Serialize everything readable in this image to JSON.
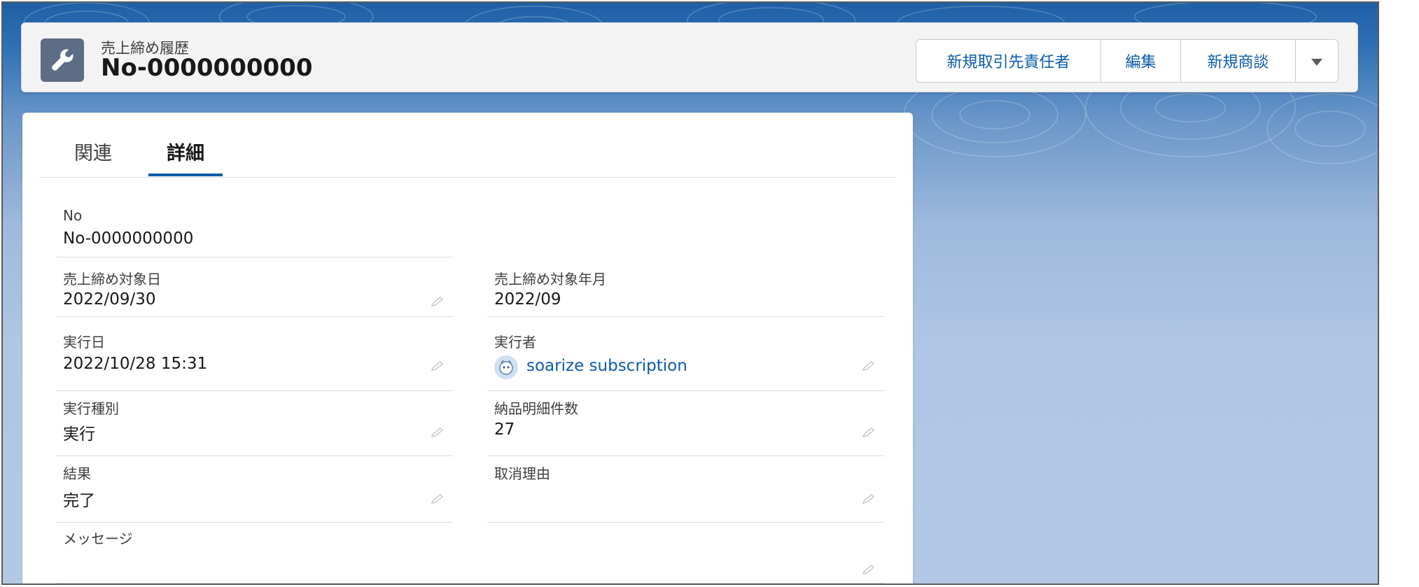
{
  "header": {
    "object_label": "売上締め履歴",
    "record_title": "No-0000000000",
    "actions": [
      {
        "label": "新規取引先責任者"
      },
      {
        "label": "編集"
      },
      {
        "label": "新規商談"
      }
    ],
    "more_icon": "chevron-down-icon"
  },
  "tabs": [
    {
      "label": "関連",
      "selected": false
    },
    {
      "label": "詳細",
      "selected": true
    }
  ],
  "fields": {
    "no": {
      "label": "No",
      "value": "No-0000000000"
    },
    "target_date": {
      "label": "売上締め対象日",
      "value": "2022/09/30"
    },
    "target_month": {
      "label": "売上締め対象年月",
      "value": "2022/09"
    },
    "exec_date": {
      "label": "実行日",
      "value": "2022/10/28 15:31"
    },
    "executor": {
      "label": "実行者",
      "value": "soarize subscription"
    },
    "exec_type": {
      "label": "実行種別",
      "value": "実行"
    },
    "line_count": {
      "label": "納品明細件数",
      "value": "27"
    },
    "result": {
      "label": "結果",
      "value": "完了"
    },
    "cancel_reason": {
      "label": "取消理由",
      "value": ""
    },
    "message": {
      "label": "メッセージ",
      "value": ""
    }
  },
  "colors": {
    "brand": "#0b5cab",
    "object_icon_bg": "#5d6d85"
  }
}
